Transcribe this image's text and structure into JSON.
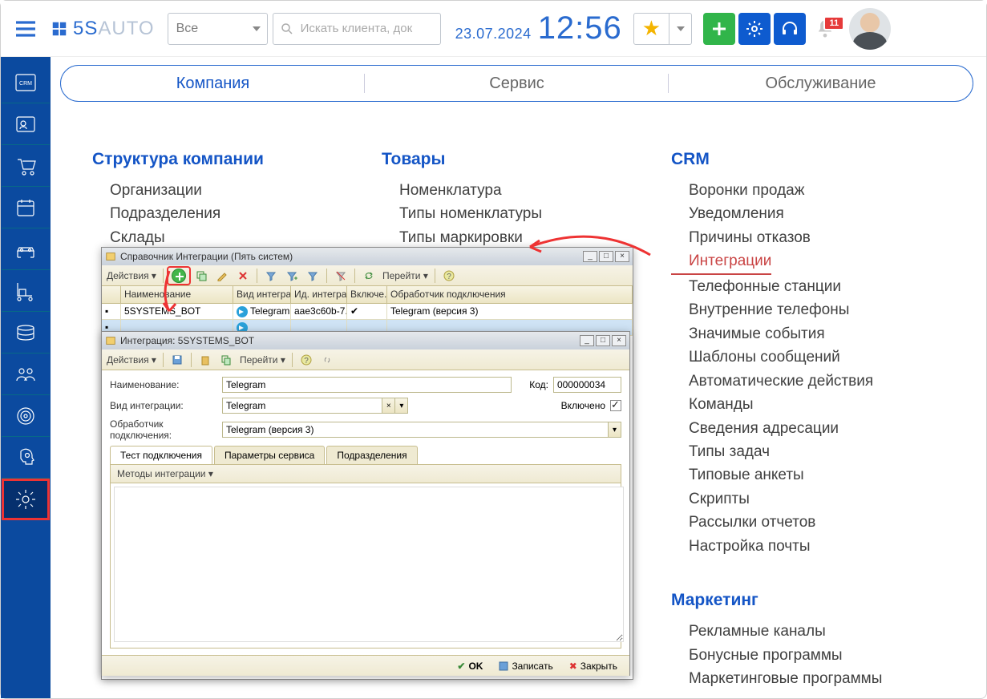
{
  "header": {
    "logo_text1": "5S",
    "logo_text2": "AUTO",
    "filter_label": "Все",
    "search_placeholder": "Искать клиента, док",
    "date": "23.07.2024",
    "time": "12:56",
    "badge_count": "11"
  },
  "page_tabs": [
    "Компания",
    "Сервис",
    "Обслуживание"
  ],
  "columns": {
    "col1": {
      "heading": "Структура компании",
      "items": [
        "Организации",
        "Подразделения",
        "Склады"
      ]
    },
    "col2": {
      "heading": "Товары",
      "items": [
        "Номенклатура",
        "Типы номенклатуры",
        "Типы маркировки"
      ]
    },
    "col3": {
      "heading": "CRM",
      "items": [
        "Воронки продаж",
        "Уведомления",
        "Причины отказов",
        "Интеграции",
        "Телефонные станции",
        "Внутренние телефоны",
        "Значимые события",
        "Шаблоны сообщений",
        "Автоматические действия",
        "Команды",
        "Сведения адресации",
        "Типы задач",
        "Типовые анкеты",
        "Скрипты",
        "Рассылки отчетов",
        "Настройка почты"
      ],
      "highlight_index": 3
    },
    "marketing": {
      "heading": "Маркетинг",
      "items": [
        "Рекламные каналы",
        "Бонусные программы",
        "Маркетинговые программы"
      ]
    }
  },
  "dlg1": {
    "title": "Справочник Интеграции (Пять систем)",
    "actions_label": "Действия",
    "goto_label": "Перейти",
    "cols": {
      "name": "Наименование",
      "type": "Вид интегра...",
      "id": "Ид. интегра...",
      "on": "Включе...",
      "handler": "Обработчик подключения"
    },
    "row1": {
      "name": "5SYSTEMS_BOT",
      "type": "Telegram",
      "id": "aae3c60b-7...",
      "on": "✔",
      "handler": "Telegram (версия 3)"
    }
  },
  "dlg2": {
    "title": "Интеграция: 5SYSTEMS_BOT",
    "actions_label": "Действия",
    "goto_label": "Перейти",
    "fields": {
      "name_label": "Наименование:",
      "name_value": "Telegram",
      "code_label": "Код:",
      "code_value": "000000034",
      "type_label": "Вид интеграции:",
      "type_value": "Telegram",
      "enabled_label": "Включено",
      "handler_label": "Обработчик подключения:",
      "handler_value": "Telegram (версия 3)"
    },
    "tabs": [
      "Тест подключения",
      "Параметры сервиса",
      "Подразделения"
    ],
    "subbar": "Методы интеграции",
    "footer": {
      "ok": "OK",
      "save": "Записать",
      "close": "Закрыть"
    }
  }
}
